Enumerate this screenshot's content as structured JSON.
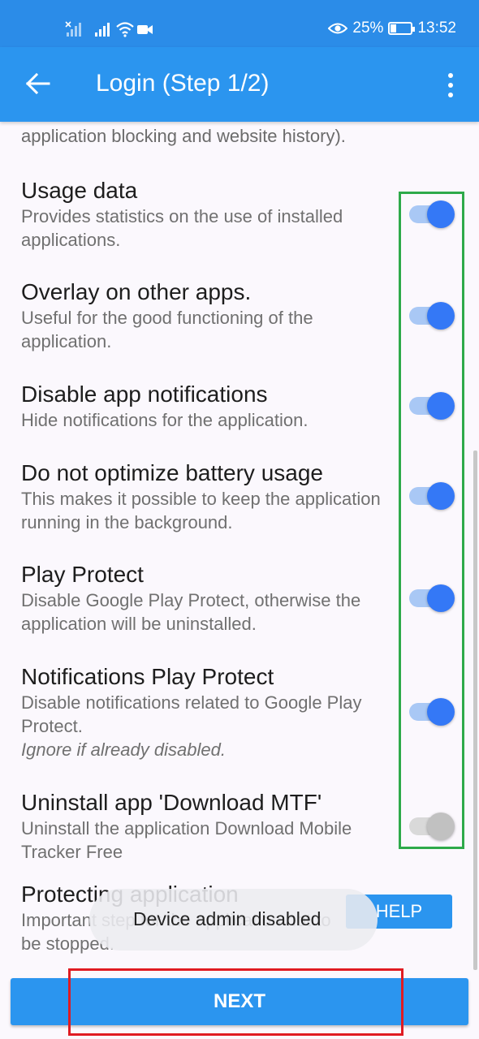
{
  "status_bar": {
    "battery_percent": "25%",
    "time": "13:52"
  },
  "app_bar": {
    "title": "Login (Step 1/2)",
    "back_icon": "arrow-left-icon",
    "menu_icon": "more-vert-icon"
  },
  "clipped_text": "application blocking and website history).",
  "items": [
    {
      "title": "Usage data",
      "description": "Provides statistics on the use of installed applications.",
      "enabled": true
    },
    {
      "title": "Overlay on other apps.",
      "description": "Useful for the good functioning of the application.",
      "enabled": true
    },
    {
      "title": "Disable app notifications",
      "description": "Hide notifications for the application.",
      "enabled": true
    },
    {
      "title": "Do not optimize battery usage",
      "description": "This makes it possible to keep the application running in the background.",
      "enabled": true
    },
    {
      "title": "Play Protect",
      "description": "Disable Google Play Protect, otherwise the application will be uninstalled.",
      "enabled": true
    },
    {
      "title": "Notifications Play Protect",
      "description": "Disable notifications related to Google Play Protect.",
      "note": "Ignore if already disabled.",
      "enabled": true
    },
    {
      "title": "Uninstall app 'Download MTF'",
      "description": "Uninstall the application Download Mobile Tracker Free",
      "enabled": false
    }
  ],
  "protecting": {
    "title": "Protecting application",
    "description": "Important step for the application not to be stopped.",
    "help_label": "HELP"
  },
  "toast": "Device admin disabled",
  "next_label": "NEXT",
  "colors": {
    "primary": "#2b95ef",
    "toggle_on": "#3478f6",
    "highlight_green": "#2eaa4a",
    "highlight_red": "#e01b22"
  }
}
